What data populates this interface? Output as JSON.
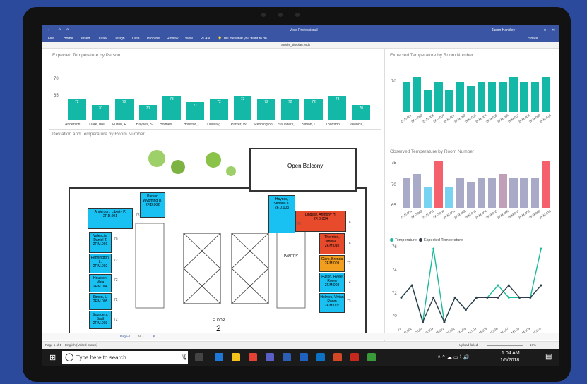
{
  "titlebar": {
    "app_title": "Visio Professional",
    "user": "Jason Handley"
  },
  "ribbon": {
    "tabs": [
      "File",
      "Home",
      "Insert",
      "Draw",
      "Design",
      "Data",
      "Process",
      "Review",
      "View",
      "PLAN"
    ],
    "tell_me": "Tell me what you want to do",
    "share": "Share"
  },
  "document": {
    "name": "Stools_siteplan.vsdx"
  },
  "chart_person": {
    "title": "Expected Temperature by Person",
    "chart_data": {
      "type": "bar",
      "title": "Expected Temperature by Person",
      "categories": [
        "Anderson...",
        "Clark, Bre...",
        "Fulton, R...",
        "Haynes, S...",
        "Holmes, ...",
        "Houston, ...",
        "Lindsay, ...",
        "Parker, W...",
        "Pennington...",
        "Saunders,...",
        "Simon, L.",
        "Thornton,...",
        "Valencia, ..."
      ],
      "values": [
        72,
        70,
        72,
        70,
        73,
        71,
        72,
        73,
        72,
        72,
        72,
        73,
        70
      ],
      "ylim": [
        65,
        75
      ],
      "yticks": [
        "70",
        "65"
      ]
    }
  },
  "chart_room_expected": {
    "title": "Expected Temperature by Room Number",
    "chart_data": {
      "type": "bar",
      "title": "Expected Temperature by Room Number",
      "categories": [
        "2F.D.001",
        "2F.D.002",
        "2F.D.003",
        "2F.D.004",
        "2F.M.001",
        "2F.M.002",
        "2F.M.003",
        "2F.M.004",
        "2F.M.005",
        "2F.M.006",
        "2F.M.007",
        "2F.M.008",
        "2F.M.009",
        "2F.M.010"
      ],
      "values": [
        72,
        73,
        70,
        72,
        70,
        72,
        71,
        72,
        72,
        72,
        73,
        72,
        72,
        73
      ],
      "ylim": [
        65,
        75
      ],
      "yticks": [
        "70"
      ]
    }
  },
  "chart_room_observed": {
    "title": "Observed Temperature by Room Number",
    "chart_data": {
      "type": "bar",
      "title": "Observed Temperature by Room Number",
      "categories": [
        "2F.D.001",
        "2F.D.002",
        "2F.D.003",
        "2F.D.004",
        "2F.M.001",
        "2F.M.002",
        "2F.M.003",
        "2F.M.004",
        "2F.M.005",
        "2F.M.006",
        "2F.M.007",
        "2F.M.008",
        "2F.M.009",
        "2F.M.010"
      ],
      "values": [
        72,
        73,
        70,
        76,
        70,
        72,
        71,
        72,
        72,
        73,
        72,
        72,
        72,
        76
      ],
      "colors": [
        "#a9a9c8",
        "#a9a9c8",
        "#78d3f3",
        "#f4606c",
        "#78d3f3",
        "#a9a9c8",
        "#a9a9c8",
        "#a9a9c8",
        "#a9a9c8",
        "#c0a0b8",
        "#a9a9c8",
        "#a9a9c8",
        "#a9a9c8",
        "#f4606c"
      ],
      "ylim": [
        65,
        76
      ],
      "yticks": [
        "75",
        "70",
        "65"
      ]
    }
  },
  "chart_line": {
    "legend": [
      "Temperature",
      "Expected Temperature"
    ],
    "chart_data": {
      "type": "line",
      "categories": [
        "2F.D.001",
        "2F.D.002",
        "2F.D.003",
        "2F.D.004",
        "2F.M.001",
        "2F.M.002",
        "2F.M.003",
        "2F.M.004",
        "2F.M.005",
        "2F.M.006",
        "2F.M.007",
        "2F.M.008",
        "2F.M.009",
        "2F.M.010"
      ],
      "series": [
        {
          "name": "Temperature",
          "color": "#1ab99a",
          "values": [
            72,
            73,
            70,
            76,
            70,
            72,
            71,
            72,
            72,
            73,
            72,
            72,
            72,
            76
          ]
        },
        {
          "name": "Expected Temperature",
          "color": "#2f3b4a",
          "values": [
            72,
            73,
            70,
            72,
            70,
            72,
            71,
            72,
            72,
            72,
            73,
            72,
            72,
            73
          ]
        }
      ],
      "ylim": [
        70,
        76
      ],
      "yticks": [
        "76",
        "74",
        "72",
        "70"
      ]
    }
  },
  "floorplan": {
    "title": "Deviation and Temperature by Room Number",
    "balcony": "Open Balcony",
    "pantry": "PANTRY",
    "floor_label": "FLOOR",
    "floor_number": "2",
    "rooms": [
      {
        "name": "Anderson, Liberty P.",
        "room": "2F.D.001",
        "temp": "",
        "color": "#19c0f2"
      },
      {
        "name": "Parker, Wyoming U.",
        "room": "2F.D.002",
        "temp": "73",
        "color": "#19c0f2"
      },
      {
        "name": "Valencia, Daniel T.",
        "room": "2F.M.001",
        "temp": "70",
        "color": "#19c0f2"
      },
      {
        "name": "Pennington, L.",
        "room": "2F.M.002",
        "temp": "72",
        "color": "#19c0f2"
      },
      {
        "name": "Houston, Maia",
        "room": "2F.M.004",
        "temp": "72",
        "color": "#19c0f2"
      },
      {
        "name": "Simon, L.",
        "room": "2F.M.005",
        "temp": "72",
        "color": "#19c0f2"
      },
      {
        "name": "Saunders, Basil",
        "room": "2F.M.003",
        "temp": "72",
        "color": "#19c0f2"
      },
      {
        "name": "Haynes, Sebana K.",
        "room": "2F.D.003",
        "temp": "70",
        "color": "#19c0f2"
      },
      {
        "name": "Lindsay, Anthony H.",
        "room": "2F.D.004",
        "temp": "76",
        "color": "#e84a2c"
      },
      {
        "name": "Thornton, Danielle L.",
        "room": "2F.M.010",
        "temp": "76",
        "color": "#e84a2c"
      },
      {
        "name": "Clark, Brenda",
        "room": "2F.M.009",
        "temp": "72",
        "color": "#f29e1f"
      },
      {
        "name": "Fulton, Rylee",
        "room": "Room 2F.M.008",
        "temp": "72",
        "color": "#19c0f2"
      },
      {
        "name": "Holmes, Vivian",
        "room": "Room 2F.M.007",
        "temp": "73",
        "color": "#19c0f2"
      }
    ]
  },
  "pages": {
    "page1": "Page-1",
    "all": "All ▴"
  },
  "statusbar": {
    "page": "Page 1 of 1",
    "lang": "English (United States)",
    "upload": "Upload failed",
    "zoom": "17%"
  },
  "taskbar": {
    "search_placeholder": "Type here to search",
    "time": "1:04 AM",
    "date": "1/5/2018"
  }
}
